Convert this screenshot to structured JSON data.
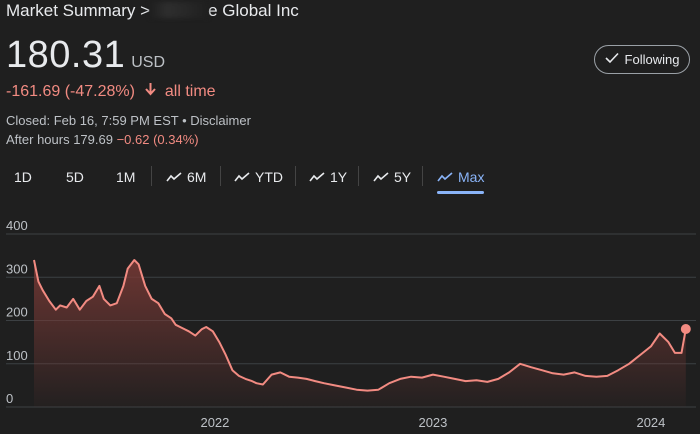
{
  "header": {
    "breadcrumb_prefix": "Market Summary >",
    "company_suffix": "e Global Inc"
  },
  "quote": {
    "price": "180.31",
    "currency": "USD",
    "change": "-161.69 (-47.28%)",
    "change_period": "all time",
    "closed_text": "Closed: Feb 16, 7:59 PM EST",
    "disclaimer": "Disclaimer",
    "after_hours_label": "After hours 179.69",
    "after_hours_change": "−0.62 (0.34%)"
  },
  "follow_button": {
    "label": "Following"
  },
  "tabs": [
    {
      "label": "1D",
      "icon": ""
    },
    {
      "label": "5D",
      "icon": ""
    },
    {
      "label": "1M",
      "icon": ""
    },
    {
      "label": "6M",
      "icon": "trend-line-icon"
    },
    {
      "label": "YTD",
      "icon": "trend-line-icon"
    },
    {
      "label": "1Y",
      "icon": "trend-line-icon"
    },
    {
      "label": "5Y",
      "icon": "trend-line-icon"
    },
    {
      "label": "Max",
      "icon": "trend-line-icon",
      "active": true
    }
  ],
  "colors": {
    "line": "#f28b82",
    "fill_top": "#7a3a36",
    "grid": "#3c4043",
    "axis_text": "#bdc1c6",
    "active_tab": "#8ab4f8"
  },
  "chart_data": {
    "type": "area",
    "ylim": [
      0,
      400
    ],
    "yticks": [
      0,
      100,
      200,
      300,
      400
    ],
    "x_ticks": [
      {
        "label": "2022",
        "value": 2022.0
      },
      {
        "label": "2023",
        "value": 2023.0
      },
      {
        "label": "2024",
        "value": 2024.0
      }
    ],
    "xlim": [
      2021.17,
      2024.17
    ],
    "x": [
      2021.17,
      2021.19,
      2021.21,
      2021.24,
      2021.27,
      2021.29,
      2021.32,
      2021.35,
      2021.38,
      2021.41,
      2021.44,
      2021.47,
      2021.49,
      2021.52,
      2021.55,
      2021.58,
      2021.6,
      2021.63,
      2021.65,
      2021.68,
      2021.71,
      2021.74,
      2021.77,
      2021.8,
      2021.82,
      2021.84,
      2021.86,
      2021.88,
      2021.91,
      2021.94,
      2021.96,
      2021.99,
      2022.02,
      2022.05,
      2022.08,
      2022.11,
      2022.14,
      2022.17,
      2022.19,
      2022.22,
      2022.26,
      2022.3,
      2022.34,
      2022.38,
      2022.42,
      2022.46,
      2022.5,
      2022.55,
      2022.6,
      2022.65,
      2022.7,
      2022.75,
      2022.8,
      2022.85,
      2022.9,
      2022.95,
      2023.0,
      2023.05,
      2023.1,
      2023.15,
      2023.2,
      2023.25,
      2023.3,
      2023.35,
      2023.4,
      2023.45,
      2023.5,
      2023.55,
      2023.6,
      2023.65,
      2023.7,
      2023.75,
      2023.8,
      2023.85,
      2023.9,
      2023.95,
      2024.0,
      2024.04,
      2024.08,
      2024.11,
      2024.14,
      2024.16
    ],
    "values": [
      340,
      290,
      270,
      245,
      225,
      235,
      230,
      250,
      225,
      245,
      255,
      280,
      250,
      235,
      240,
      280,
      320,
      340,
      330,
      280,
      250,
      240,
      215,
      205,
      190,
      185,
      180,
      175,
      165,
      180,
      185,
      175,
      150,
      120,
      85,
      72,
      65,
      60,
      55,
      52,
      75,
      80,
      70,
      68,
      65,
      60,
      55,
      50,
      45,
      40,
      38,
      40,
      55,
      65,
      70,
      68,
      75,
      70,
      65,
      60,
      62,
      58,
      65,
      80,
      100,
      92,
      85,
      78,
      75,
      80,
      72,
      70,
      72,
      85,
      100,
      120,
      140,
      170,
      150,
      125,
      125,
      180
    ],
    "end_marker_value": 180.31
  }
}
